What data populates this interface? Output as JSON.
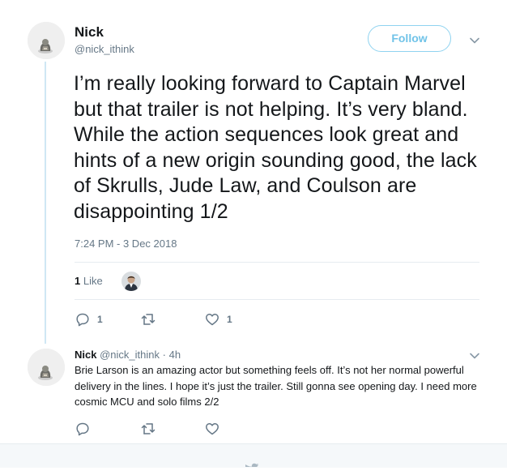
{
  "main_tweet": {
    "author_name": "Nick",
    "author_handle": "@nick_ithink",
    "follow_label": "Follow",
    "text": "I’m really looking forward to Captain Marvel but that trailer is not helping. It’s very bland. While the action sequences look great and hints of a new origin sounding good, the lack of Skrulls, Jude Law, and Coulson are disappointing 1/2",
    "timestamp": "7:24 PM - 3 Dec 2018",
    "likes_count": "1",
    "likes_label": "Like",
    "actions": {
      "reply_count": "1",
      "retweet_count": "",
      "like_count": "1"
    }
  },
  "reply_tweet": {
    "author_name": "Nick",
    "author_handle": "@nick_ithink",
    "separator": "·",
    "time": "4h",
    "text": "Brie Larson is an amazing actor but something feels off. It’s not her normal powerful delivery in the lines. I hope it’s just the trailer. Still gonna see opening day. I need more cosmic MCU and solo films 2/2"
  },
  "icons": {
    "reply": "reply-icon",
    "retweet": "retweet-icon",
    "like": "heart-icon",
    "more": "chevron-down-icon",
    "footer": "twitter-bird-icon"
  },
  "colors": {
    "accent": "#1da1f2",
    "follow_text": "#70c3e8",
    "secondary_text": "#657786",
    "thread_line": "#cfe7f4",
    "divider": "#e6ecf0"
  }
}
